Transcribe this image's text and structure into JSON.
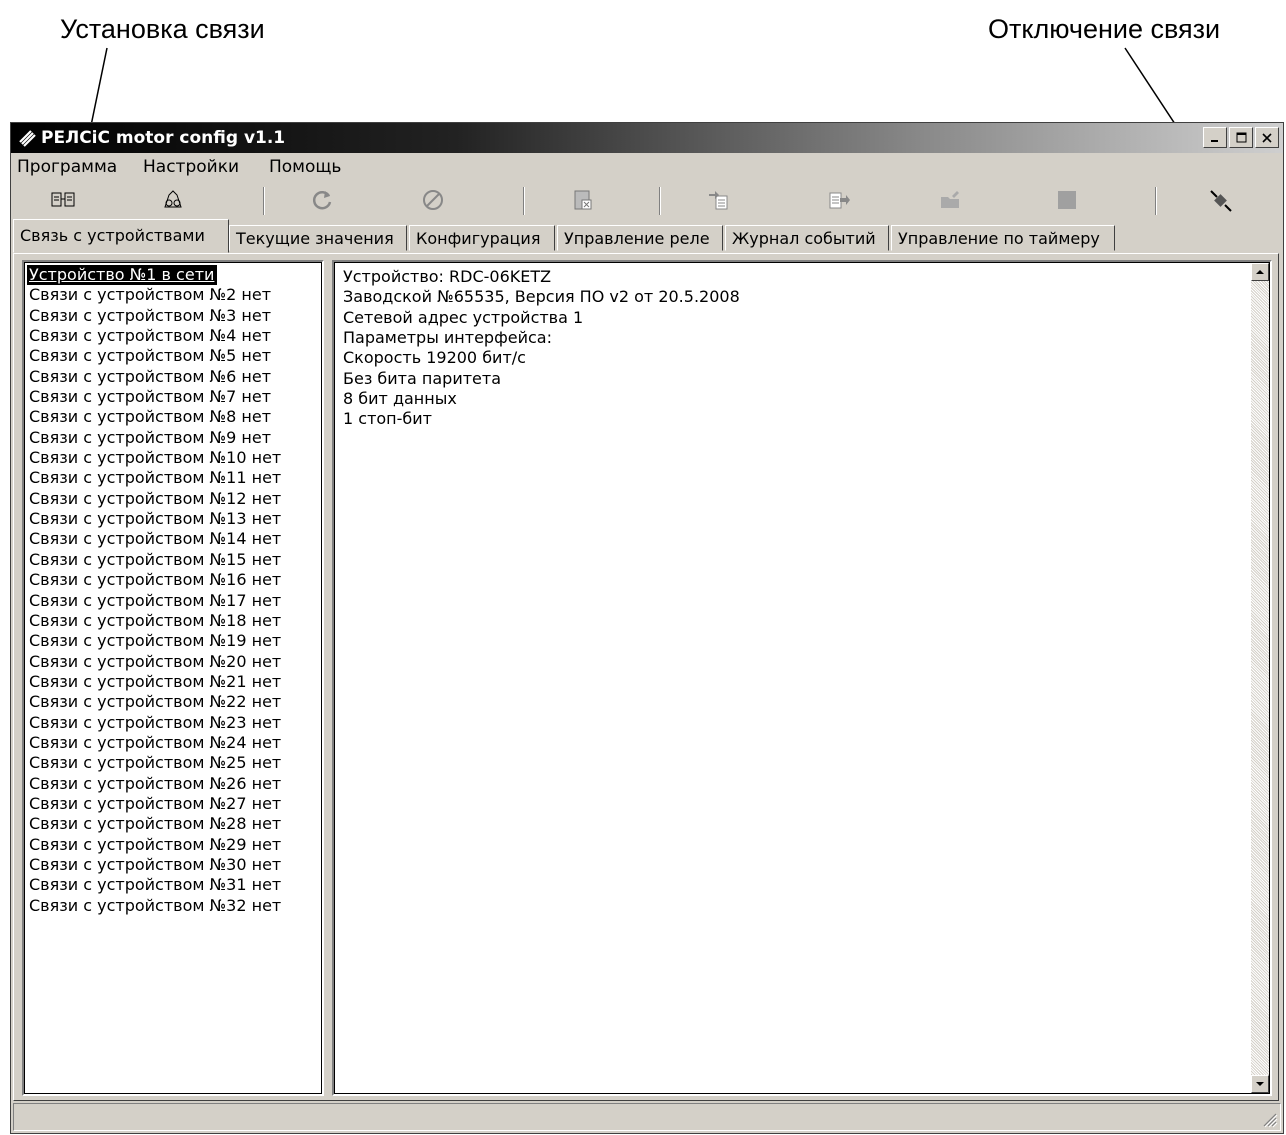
{
  "annotations": {
    "connect": "Установка связи",
    "disconnect": "Отключение связи"
  },
  "window": {
    "title": "РЕЛСіС motor config v1.1",
    "app_icon": "app-logo-icon",
    "controls": [
      "minimize-icon",
      "maximize-icon",
      "close-icon"
    ]
  },
  "menu": {
    "items": [
      "Программа",
      "Настройки",
      "Помощь"
    ]
  },
  "toolbar": {
    "buttons": [
      {
        "icon": "connect-icon"
      },
      {
        "icon": "search-devices-icon"
      },
      {
        "icon": "refresh-icon"
      },
      {
        "icon": "cancel-icon"
      },
      {
        "icon": "import-icon"
      },
      {
        "icon": "write-icon"
      },
      {
        "icon": "send-icon"
      },
      {
        "icon": "open-folder-icon"
      },
      {
        "icon": "stop-icon"
      },
      {
        "icon": "disconnect-icon"
      }
    ]
  },
  "tabs": [
    {
      "label": "Связь с устройствами",
      "active": true
    },
    {
      "label": "Текущие значения"
    },
    {
      "label": "Конфигурация"
    },
    {
      "label": "Управление реле"
    },
    {
      "label": "Журнал событий"
    },
    {
      "label": "Управление по таймеру"
    }
  ],
  "devices": [
    "Устройство №1 в сети",
    "Связи с устройством №2 нет",
    "Связи с устройством №3 нет",
    "Связи с устройством №4 нет",
    "Связи с устройством №5 нет",
    "Связи с устройством №6 нет",
    "Связи с устройством №7 нет",
    "Связи с устройством №8 нет",
    "Связи с устройством №9 нет",
    "Связи с устройством №10 нет",
    "Связи с устройством №11 нет",
    "Связи с устройством №12 нет",
    "Связи с устройством №13 нет",
    "Связи с устройством №14 нет",
    "Связи с устройством №15 нет",
    "Связи с устройством №16 нет",
    "Связи с устройством №17 нет",
    "Связи с устройством №18 нет",
    "Связи с устройством №19 нет",
    "Связи с устройством №20 нет",
    "Связи с устройством №21 нет",
    "Связи с устройством №22 нет",
    "Связи с устройством №23 нет",
    "Связи с устройством №24 нет",
    "Связи с устройством №25 нет",
    "Связи с устройством №26 нет",
    "Связи с устройством №27 нет",
    "Связи с устройством №28 нет",
    "Связи с устройством №29 нет",
    "Связи с устройством №30 нет",
    "Связи с устройством №31 нет",
    "Связи с устройством №32 нет"
  ],
  "selected_device": 0,
  "info_lines": [
    "Устройство: RDC-06KETZ",
    "Заводской №65535, Версия ПО v2 от 20.5.2008",
    "Сетевой адрес устройства 1",
    "Параметры интерфейса:",
    "Скорость 19200 бит/с",
    "Без бита паритета",
    "8 бит данных",
    "1 стоп-бит"
  ],
  "status": {
    "text": ""
  }
}
